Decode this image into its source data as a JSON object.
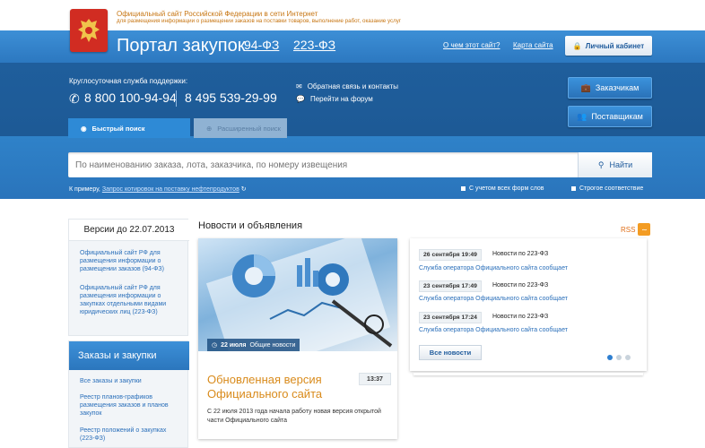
{
  "top": {
    "line1": "Официальный сайт Российской Федерации в сети Интернет",
    "line2": "для размещения информации о размещении заказов на поставки товаров, выполнение работ, оказание услуг"
  },
  "header": {
    "portal_title": "Портал закупок",
    "law1": "94-ФЗ",
    "law2": "223-ФЗ",
    "about_link": "О чем этот сайт?",
    "sitemap_link": "Карта сайта",
    "cabinet_label": "Личный кабинет"
  },
  "support": {
    "label": "Круглосуточная служба поддержки:",
    "phone1": "8 800 100-94-94",
    "phone2": "8 495 539-29-99",
    "feedback": "Обратная связь и контакты",
    "forum": "Перейти на форум"
  },
  "side_buttons": {
    "customers": "Заказчикам",
    "suppliers": "Поставщикам"
  },
  "search": {
    "tab_quick": "Быстрый поиск",
    "tab_advanced": "Расширенный поиск",
    "placeholder": "По наименованию заказа, лота, заказчика, по номеру извещения",
    "button": "Найти",
    "example_prefix": "К примеру,",
    "example_link": "Запрос котировок на поставку нефтепродуктов",
    "opt_all_forms": "С учетом всех форм слов",
    "opt_strict": "Строгое соответствие"
  },
  "left": {
    "versions_title": "Версии до 22.07.2013",
    "version_link1": "Официальный сайт РФ для размещения информации о размещении заказов (94-ФЗ)",
    "version_link2": "Официальный сайт РФ для размещения информации о закупках отдельными видами юридических лиц (223-ФЗ)",
    "orders_title": "Заказы и закупки",
    "orders_link1": "Все заказы и закупки",
    "orders_link2": "Реестр планов-графиков размещения заказов и планов закупок",
    "orders_link3": "Реестр положений о закупках (223-ФЗ)"
  },
  "news": {
    "heading": "Новости и объявления",
    "rss": "RSS",
    "feature_date": "22 июля",
    "feature_category": "Общие новости",
    "feature_title": "Обновленная версия Официального сайта",
    "feature_time": "13:37",
    "feature_text": "С 22 июля 2013 года начала работу новая версия открытой части Официального сайта",
    "items": [
      {
        "date": "26 сентября 19:49",
        "category": "Новости по 223-ФЗ",
        "source": "Служба оператора Официального сайта сообщает"
      },
      {
        "date": "23 сентября 17:49",
        "category": "Новости по 223-ФЗ",
        "source": "Служба оператора Официального сайта сообщает"
      },
      {
        "date": "23 сентября 17:24",
        "category": "Новости по 223-ФЗ",
        "source": "Служба оператора Официального сайта сообщает"
      }
    ],
    "all_news": "Все новости"
  },
  "colors": {
    "header_blue": "#1f5e9c",
    "accent_orange": "#d98b1c",
    "link_blue": "#2a6fba"
  }
}
